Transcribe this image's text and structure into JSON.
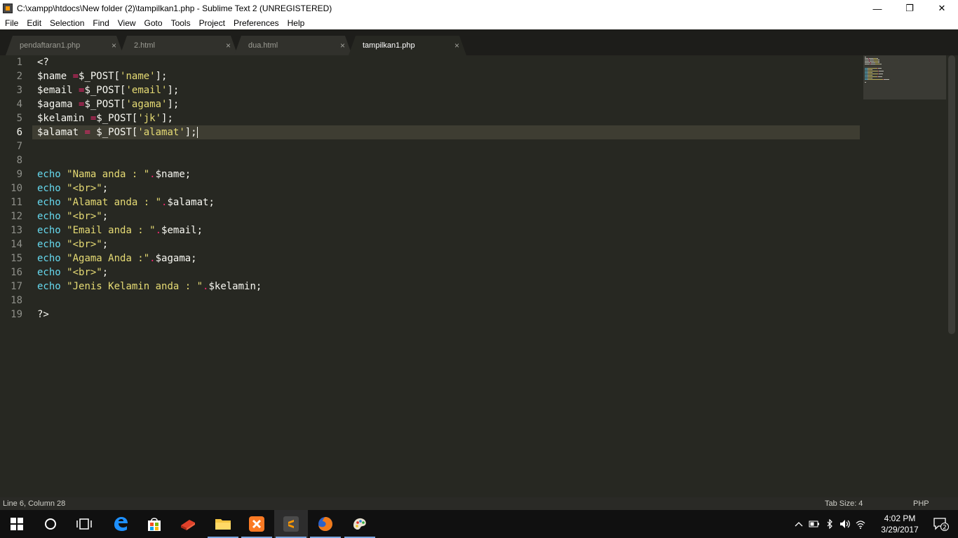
{
  "window": {
    "title": "C:\\xampp\\htdocs\\New folder (2)\\tampilkan1.php - Sublime Text 2 (UNREGISTERED)",
    "minimize_glyph": "—",
    "maximize_glyph": "❐",
    "close_glyph": "✕"
  },
  "menu": [
    "File",
    "Edit",
    "Selection",
    "Find",
    "View",
    "Goto",
    "Tools",
    "Project",
    "Preferences",
    "Help"
  ],
  "tabs": [
    {
      "label": "pendaftaran1.php",
      "close": "×",
      "active": false
    },
    {
      "label": "2.html",
      "close": "×",
      "active": false
    },
    {
      "label": "dua.html",
      "close": "×",
      "active": false
    },
    {
      "label": "tampilkan1.php",
      "close": "×",
      "active": true
    }
  ],
  "editor": {
    "current_line": 6,
    "line_numbers": [
      "1",
      "2",
      "3",
      "4",
      "5",
      "6",
      "7",
      "8",
      "9",
      "10",
      "11",
      "12",
      "13",
      "14",
      "15",
      "16",
      "17",
      "18",
      "19"
    ],
    "lines": [
      [
        {
          "t": "plain",
          "v": "<?"
        }
      ],
      [
        {
          "t": "plain",
          "v": "$name "
        },
        {
          "t": "op",
          "v": "="
        },
        {
          "t": "plain",
          "v": "$_POST["
        },
        {
          "t": "str",
          "v": "'name'"
        },
        {
          "t": "plain",
          "v": "];"
        }
      ],
      [
        {
          "t": "plain",
          "v": "$email "
        },
        {
          "t": "op",
          "v": "="
        },
        {
          "t": "plain",
          "v": "$_POST["
        },
        {
          "t": "str",
          "v": "'email'"
        },
        {
          "t": "plain",
          "v": "];"
        }
      ],
      [
        {
          "t": "plain",
          "v": "$agama "
        },
        {
          "t": "op",
          "v": "="
        },
        {
          "t": "plain",
          "v": "$_POST["
        },
        {
          "t": "str",
          "v": "'agama'"
        },
        {
          "t": "plain",
          "v": "];"
        }
      ],
      [
        {
          "t": "plain",
          "v": "$kelamin "
        },
        {
          "t": "op",
          "v": "="
        },
        {
          "t": "plain",
          "v": "$_POST["
        },
        {
          "t": "str",
          "v": "'jk'"
        },
        {
          "t": "plain",
          "v": "];"
        }
      ],
      [
        {
          "t": "plain",
          "v": "$alamat "
        },
        {
          "t": "op",
          "v": "="
        },
        {
          "t": "plain",
          "v": " $_POST["
        },
        {
          "t": "str",
          "v": "'alamat'"
        },
        {
          "t": "plain",
          "v": "];"
        }
      ],
      [],
      [],
      [
        {
          "t": "kw",
          "v": "echo"
        },
        {
          "t": "plain",
          "v": " "
        },
        {
          "t": "str",
          "v": "\"Nama anda : \""
        },
        {
          "t": "op",
          "v": "."
        },
        {
          "t": "plain",
          "v": "$name;"
        }
      ],
      [
        {
          "t": "kw",
          "v": "echo"
        },
        {
          "t": "plain",
          "v": " "
        },
        {
          "t": "str",
          "v": "\"<br>\""
        },
        {
          "t": "plain",
          "v": ";"
        }
      ],
      [
        {
          "t": "kw",
          "v": "echo"
        },
        {
          "t": "plain",
          "v": " "
        },
        {
          "t": "str",
          "v": "\"Alamat anda : \""
        },
        {
          "t": "op",
          "v": "."
        },
        {
          "t": "plain",
          "v": "$alamat;"
        }
      ],
      [
        {
          "t": "kw",
          "v": "echo"
        },
        {
          "t": "plain",
          "v": " "
        },
        {
          "t": "str",
          "v": "\"<br>\""
        },
        {
          "t": "plain",
          "v": ";"
        }
      ],
      [
        {
          "t": "kw",
          "v": "echo"
        },
        {
          "t": "plain",
          "v": " "
        },
        {
          "t": "str",
          "v": "\"Email anda : \""
        },
        {
          "t": "op",
          "v": "."
        },
        {
          "t": "plain",
          "v": "$email;"
        }
      ],
      [
        {
          "t": "kw",
          "v": "echo"
        },
        {
          "t": "plain",
          "v": " "
        },
        {
          "t": "str",
          "v": "\"<br>\""
        },
        {
          "t": "plain",
          "v": ";"
        }
      ],
      [
        {
          "t": "kw",
          "v": "echo"
        },
        {
          "t": "plain",
          "v": " "
        },
        {
          "t": "str",
          "v": "\"Agama Anda :\""
        },
        {
          "t": "op",
          "v": "."
        },
        {
          "t": "plain",
          "v": "$agama;"
        }
      ],
      [
        {
          "t": "kw",
          "v": "echo"
        },
        {
          "t": "plain",
          "v": " "
        },
        {
          "t": "str",
          "v": "\"<br>\""
        },
        {
          "t": "plain",
          "v": ";"
        }
      ],
      [
        {
          "t": "kw",
          "v": "echo"
        },
        {
          "t": "plain",
          "v": " "
        },
        {
          "t": "str",
          "v": "\"Jenis Kelamin anda : \""
        },
        {
          "t": "op",
          "v": "."
        },
        {
          "t": "plain",
          "v": "$kelamin;"
        }
      ],
      [],
      [
        {
          "t": "plain",
          "v": "?>"
        }
      ]
    ]
  },
  "status": {
    "position": "Line 6, Column 28",
    "tab_size": "Tab Size: 4",
    "syntax": "PHP"
  },
  "taskbar": {
    "clock_time": "4:02 PM",
    "clock_date": "3/29/2017",
    "notification_count": "2"
  },
  "colors": {
    "editor_bg": "#272822",
    "keyword": "#66d9ef",
    "string": "#e6db74",
    "operator": "#f92672",
    "text": "#f8f8f2",
    "gutter": "#8f908a"
  }
}
